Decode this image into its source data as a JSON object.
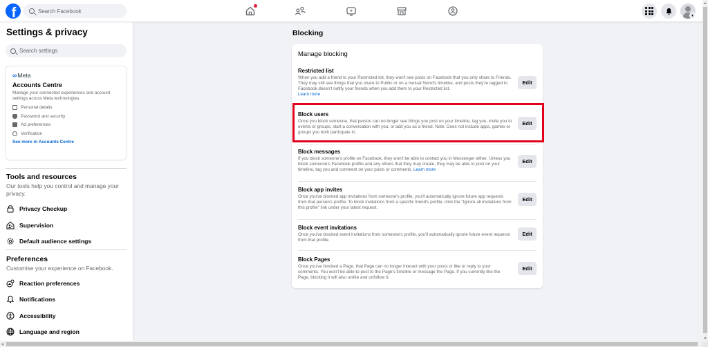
{
  "topbar": {
    "logo": "f",
    "search_placeholder": "Search Facebook",
    "nav_icons": [
      "home-icon",
      "friends-icon",
      "watch-icon",
      "marketplace-icon",
      "groups-icon"
    ],
    "home_has_notification": true,
    "right_icons": [
      "menu-grid-icon",
      "notifications-bell-icon",
      "account-avatar"
    ]
  },
  "sidebar": {
    "title": "Settings & privacy",
    "search_placeholder": "Search settings",
    "accounts_centre": {
      "brand": "Meta",
      "title": "Accounts Centre",
      "description": "Manage your connected experiences and account settings across Meta technologies.",
      "items": [
        {
          "label": "Personal details",
          "icon": "id-card-icon"
        },
        {
          "label": "Password and security",
          "icon": "shield-icon"
        },
        {
          "label": "Ad preferences",
          "icon": "ad-icon"
        },
        {
          "label": "Verification",
          "icon": "verification-icon"
        }
      ],
      "link": "See more in Accounts Centre"
    },
    "tools": {
      "title": "Tools and resources",
      "description": "Our tools help you control and manage your privacy.",
      "items": [
        {
          "label": "Privacy Checkup",
          "icon": "lock-icon"
        },
        {
          "label": "Supervision",
          "icon": "supervision-icon"
        },
        {
          "label": "Default audience settings",
          "icon": "gear-icon"
        }
      ]
    },
    "preferences": {
      "title": "Preferences",
      "description": "Customise your experience on Facebook.",
      "items": [
        {
          "label": "Reaction preferences",
          "icon": "reaction-icon"
        },
        {
          "label": "Notifications",
          "icon": "bell-icon"
        },
        {
          "label": "Accessibility",
          "icon": "accessibility-icon"
        },
        {
          "label": "Language and region",
          "icon": "globe-icon"
        }
      ]
    }
  },
  "main": {
    "title": "Blocking",
    "card_title": "Manage blocking",
    "edit_label": "Edit",
    "learn_more": "Learn more",
    "items": [
      {
        "title": "Restricted list",
        "description": "When you add a friend to your Restricted list, they won't see posts on Facebook that you only share to Friends. They may still see things that you share to Public or on a mutual friend's timeline, and posts they're tagged in. Facebook doesn't notify your friends when you add them to your Restricted list.",
        "has_learn_more": true,
        "highlighted": false
      },
      {
        "title": "Block users",
        "description": "Once you block someone, that person can no longer see things you post on your timeline, tag you, invite you to events or groups, start a conversation with you, or add you as a friend. Note: Does not include apps, games or groups you both participate in.",
        "has_learn_more": false,
        "highlighted": true
      },
      {
        "title": "Block messages",
        "description": "If you block someone's profile on Facebook, they won't be able to contact you in Messenger either. Unless you block someone's Facebook profile and any others that they may create, they may be able to post on your timeline, tag you and comment on your posts or comments.",
        "has_learn_more": true,
        "highlighted": false
      },
      {
        "title": "Block app invites",
        "description": "Once you've blocked app invitations from someone's profile, you'll automatically ignore future app requests from that person's profile. To block invitations from a specific friend's profile, click the \"Ignore all invitations from this profile\" link under your latest request.",
        "has_learn_more": false,
        "highlighted": false
      },
      {
        "title": "Block event invitations",
        "description": "Once you've blocked event invitations from someone's profile, you'll automatically ignore future event requests from that profile.",
        "has_learn_more": false,
        "highlighted": false
      },
      {
        "title": "Block Pages",
        "description": "Once you've blocked a Page, that Page can no longer interact with your posts or like or reply to your comments. You won't be able to post to the Page's timeline or message the Page. If you currently like the Page, blocking it will also unlike and unfollow it.",
        "has_learn_more": false,
        "highlighted": false
      }
    ]
  },
  "colors": {
    "brand_blue": "#0866ff",
    "link_blue": "#0064d1",
    "highlight_red": "#e2001a",
    "notification_red": "#e41e3f",
    "page_bg": "#f0f2f5"
  }
}
